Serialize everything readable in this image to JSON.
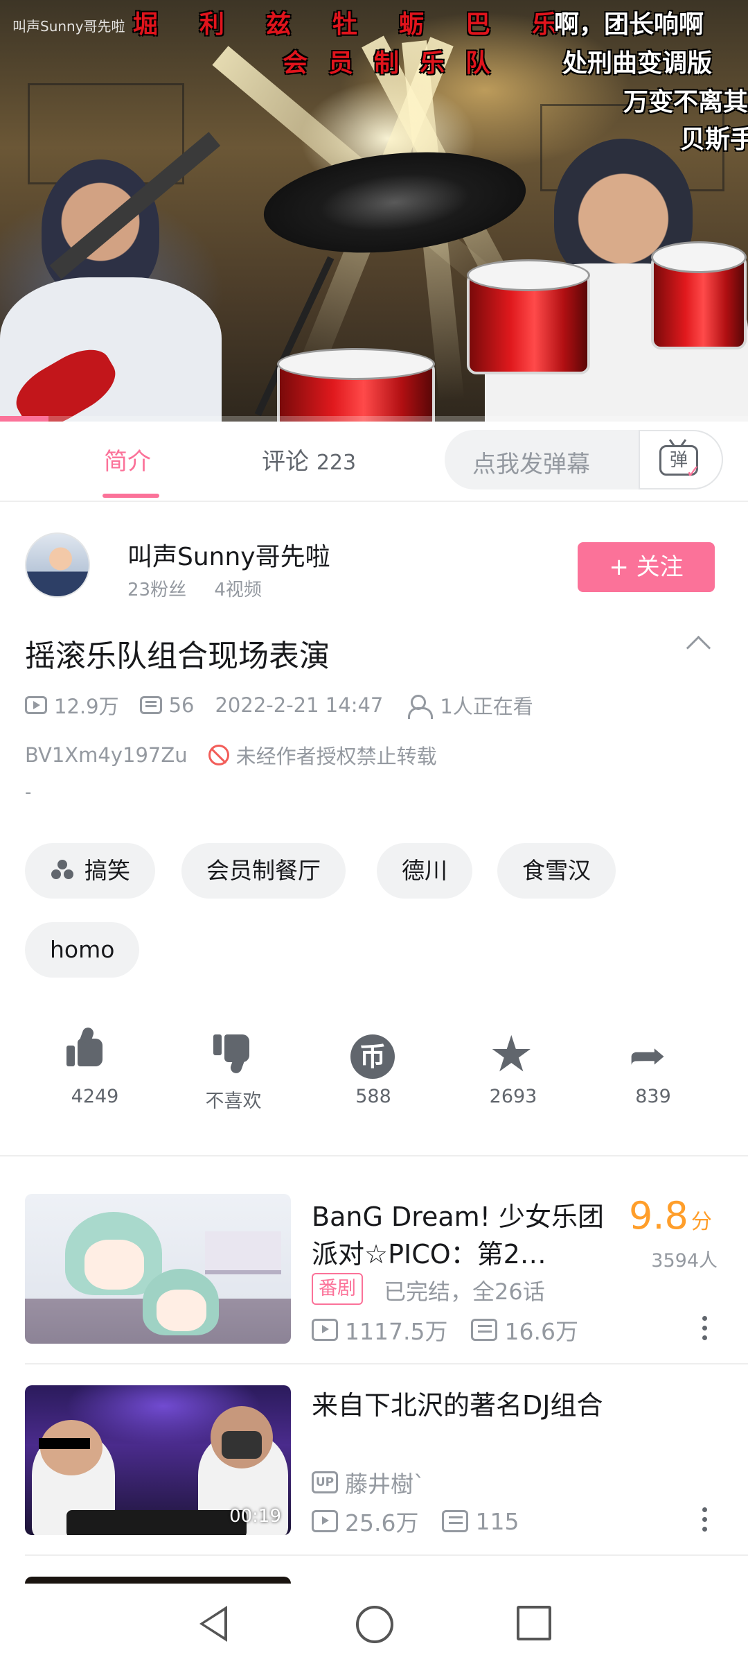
{
  "player": {
    "watermark": "叫声Sunny哥先啦",
    "danmaku": [
      "堀利兹牡蛎巴乐",
      "啊，团长响啊",
      "会员制乐队",
      "处刑曲变调版",
      "万变不离其",
      "贝斯手"
    ],
    "progress": 0.065
  },
  "tabs": {
    "intro": "简介",
    "comments": "评论",
    "comments_count": "223",
    "danmaku_placeholder": "点我发弹幕",
    "danmaku_toggle": "弹"
  },
  "uploader": {
    "name": "叫声Sunny哥先啦",
    "fans": "23粉丝",
    "videos": "4视频",
    "follow": "+ 关注"
  },
  "video": {
    "title": "摇滚乐队组合现场表演",
    "views": "12.9万",
    "danmaku_count": "56",
    "date": "2022-2-21 14:47",
    "watching": "1人正在看",
    "bvid": "BV1Xm4y197Zu",
    "copyright": "未经作者授权禁止转载",
    "description": "-"
  },
  "tags": [
    "搞笑",
    "会员制餐厅",
    "德川",
    "食雪汉",
    "homo"
  ],
  "actions": {
    "like": "4249",
    "dislike": "不喜欢",
    "coin": "588",
    "favorite": "2693",
    "share": "839",
    "coin_glyph": "币"
  },
  "related": [
    {
      "title": "BanG Dream! 少女乐团派对☆PICO：第2…",
      "score": "9.8",
      "score_unit": "分",
      "rating_count": "3594人",
      "badge": "番剧",
      "status": "已完结，全26话",
      "views": "1117.5万",
      "danmaku": "16.6万"
    },
    {
      "title": "来自下北沢的著名DJ组合",
      "duration": "00:19",
      "up_badge": "UP",
      "uploader": "藤井樹`",
      "views": "25.6万",
      "danmaku": "115"
    }
  ],
  "colors": {
    "accent": "#fb7299",
    "score": "#ff9e2a",
    "muted": "#9499a0",
    "warning": "#f25d59"
  }
}
